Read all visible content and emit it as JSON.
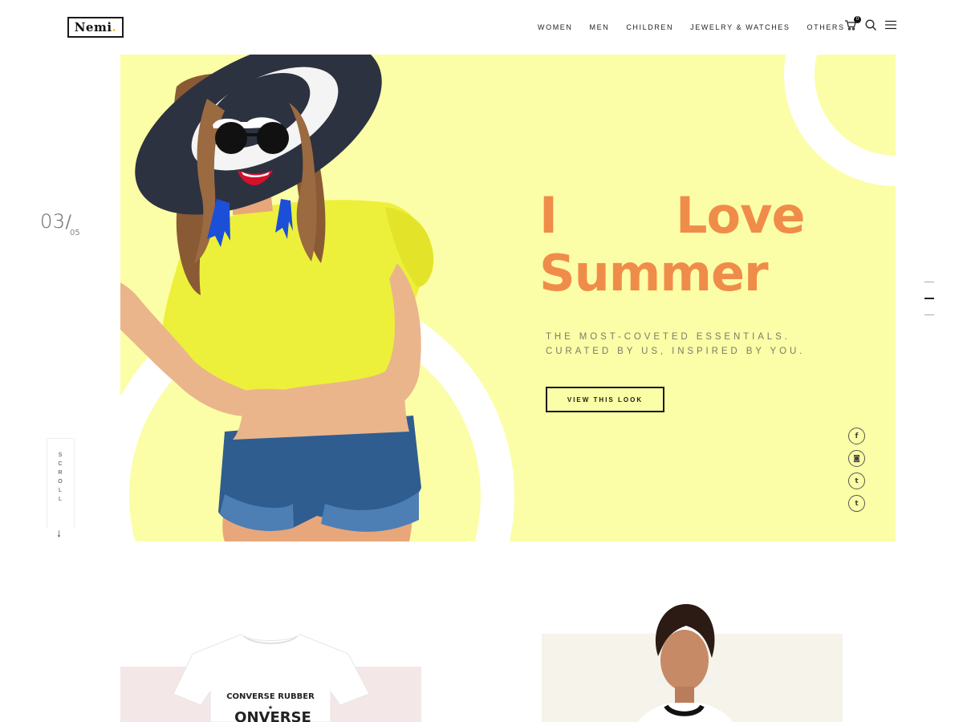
{
  "brand": {
    "logo_text": "Nemi",
    "logo_dot": "."
  },
  "nav": {
    "items": [
      {
        "label": "WOMEN"
      },
      {
        "label": "MEN"
      },
      {
        "label": "CHILDREN"
      },
      {
        "label": "JEWELRY & WATCHES"
      },
      {
        "label": "OTHERS"
      }
    ]
  },
  "header_icons": {
    "cart": "cart-icon",
    "cart_count": "0",
    "search": "search-icon",
    "menu": "hamburger-menu-icon"
  },
  "hero": {
    "slide_current": "03",
    "slide_slash": "/",
    "slide_total": "05",
    "title_word_1": "I",
    "title_word_2": "Love",
    "title_line_2": "Summer",
    "subtitle_line_1": "THE MOST-COVETED ESSENTIALS.",
    "subtitle_line_2": "CURATED BY US, INSPIRED BY YOU.",
    "cta_label": "VIEW THIS LOOK",
    "background_color": "#fbfea6",
    "title_color": "#f08c4a"
  },
  "scroll": {
    "letters": [
      "S",
      "C",
      "R",
      "O",
      "L",
      "L"
    ],
    "arrow": "↓"
  },
  "social": [
    {
      "icon": "facebook-icon",
      "glyph": "f"
    },
    {
      "icon": "instagram-icon",
      "glyph": "◙"
    },
    {
      "icon": "twitter-icon",
      "glyph": "t"
    },
    {
      "icon": "tumblr-icon",
      "glyph": "t"
    }
  ],
  "pager": {
    "count": 3,
    "active_index": 1
  },
  "products": {
    "tshirt_print_top": "CONVERSE RUBBER",
    "tshirt_print_bottom": "ONVERSE"
  }
}
